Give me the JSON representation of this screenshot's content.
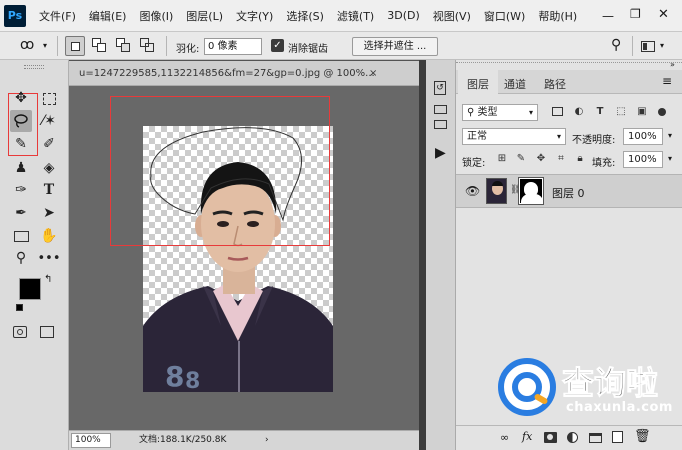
{
  "app": {
    "logo": "Ps"
  },
  "menu": [
    "文件(F)",
    "编辑(E)",
    "图像(I)",
    "图层(L)",
    "文字(Y)",
    "选择(S)",
    "滤镜(T)",
    "3D(D)",
    "视图(V)",
    "窗口(W)",
    "帮助(H)"
  ],
  "options": {
    "feather_label": "羽化:",
    "feather_value": "0 像素",
    "antialias_label": "消除锯齿",
    "antialias_checked": true,
    "select_mask_button": "选择并遮住 ..."
  },
  "document": {
    "tab_title": "u=1247229585,1132214856&fm=27&gp=0.jpg @ 100%...",
    "zoom": "100%",
    "doc_info": "文档:188.1K/250.8K"
  },
  "layers_panel": {
    "tabs": [
      "图层",
      "通道",
      "路径"
    ],
    "kind_filter": "类型",
    "blend_mode": "正常",
    "opacity_label": "不透明度:",
    "opacity_value": "100%",
    "lock_label": "锁定:",
    "fill_label": "填充:",
    "fill_value": "100%",
    "layers": [
      {
        "name": "图层 0",
        "visible": true
      }
    ],
    "bottom_icons": [
      "link-icon",
      "fx-icon",
      "mask-icon",
      "adjustment-icon",
      "group-icon",
      "new-layer-icon",
      "trash-icon"
    ]
  },
  "watermark": {
    "brand": "查询啦",
    "url": "chaxunla.com"
  },
  "colors": {
    "accent_selection": "#e83a3a",
    "watermark_blue": "#2a7de1",
    "watermark_orange": "#f5a623",
    "ps_logo_bg": "#001e36",
    "ps_logo_text": "#31a8ff"
  }
}
